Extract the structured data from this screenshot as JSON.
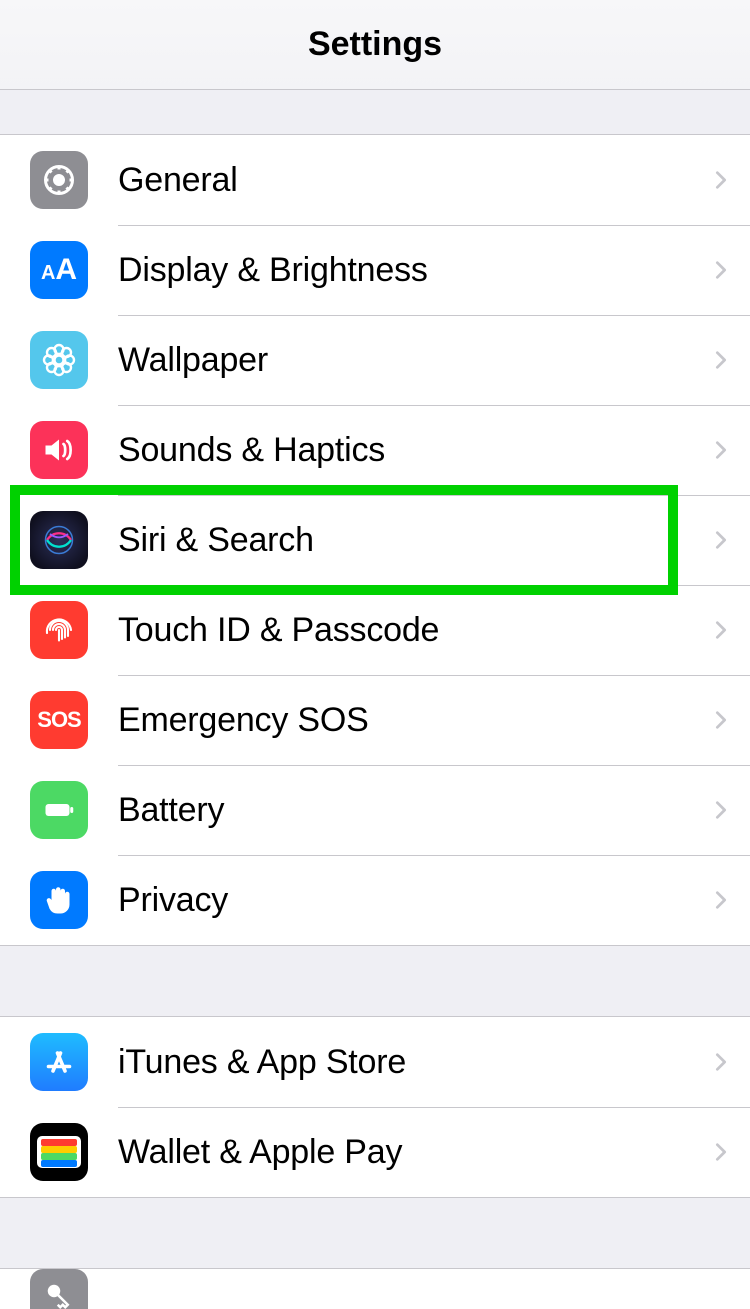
{
  "header": {
    "title": "Settings"
  },
  "sections": [
    {
      "items": [
        {
          "id": "general",
          "label": "General",
          "icon": "gear-icon",
          "icon_bg": "gray"
        },
        {
          "id": "display",
          "label": "Display & Brightness",
          "icon": "aa-icon",
          "icon_bg": "blue"
        },
        {
          "id": "wallpaper",
          "label": "Wallpaper",
          "icon": "flower-icon",
          "icon_bg": "cyan"
        },
        {
          "id": "sounds",
          "label": "Sounds & Haptics",
          "icon": "speaker-icon",
          "icon_bg": "pink"
        },
        {
          "id": "siri",
          "label": "Siri & Search",
          "icon": "siri-icon",
          "icon_bg": "siri",
          "highlighted": true
        },
        {
          "id": "touchid",
          "label": "Touch ID & Passcode",
          "icon": "fingerprint-icon",
          "icon_bg": "red"
        },
        {
          "id": "sos",
          "label": "Emergency SOS",
          "icon": "sos-icon",
          "icon_bg": "darkred"
        },
        {
          "id": "battery",
          "label": "Battery",
          "icon": "battery-icon",
          "icon_bg": "green"
        },
        {
          "id": "privacy",
          "label": "Privacy",
          "icon": "hand-icon",
          "icon_bg": "blue"
        }
      ]
    },
    {
      "items": [
        {
          "id": "appstore",
          "label": "iTunes & App Store",
          "icon": "appstore-icon",
          "icon_bg": "blue"
        },
        {
          "id": "wallet",
          "label": "Wallet & Apple Pay",
          "icon": "wallet-icon",
          "icon_bg": "black"
        }
      ]
    },
    {
      "items": [
        {
          "id": "passwords",
          "label": "",
          "icon": "key-icon",
          "icon_bg": "gray2"
        }
      ]
    }
  ]
}
